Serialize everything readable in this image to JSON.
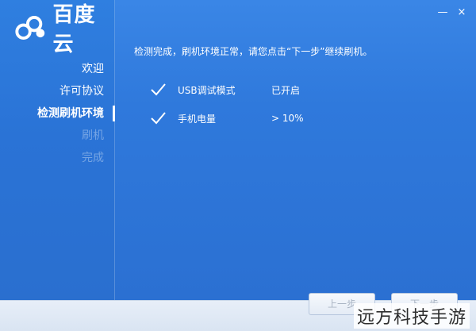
{
  "app": {
    "name": "百度云"
  },
  "window_controls": {
    "minimize": "—",
    "close": "×"
  },
  "nav": {
    "items": [
      {
        "label": "欢迎",
        "state": "done"
      },
      {
        "label": "许可协议",
        "state": "done"
      },
      {
        "label": "检测刷机环境",
        "state": "current"
      },
      {
        "label": "刷机",
        "state": "pending"
      },
      {
        "label": "完成",
        "state": "pending"
      }
    ]
  },
  "main": {
    "intro": "检测完成，刷机环境正常，请您点击“下一步”继续刷机。",
    "checks": [
      {
        "label": "USB调试模式",
        "value": "已开启"
      },
      {
        "label": "手机电量",
        "value": "> 10%"
      }
    ]
  },
  "buttons": {
    "prev": "上一步",
    "next": "下一步"
  },
  "watermark": "远方科技手游",
  "colors": {
    "accent": "#2b6fd2",
    "sidebar": "#2a73d6",
    "text": "#ffffff"
  }
}
